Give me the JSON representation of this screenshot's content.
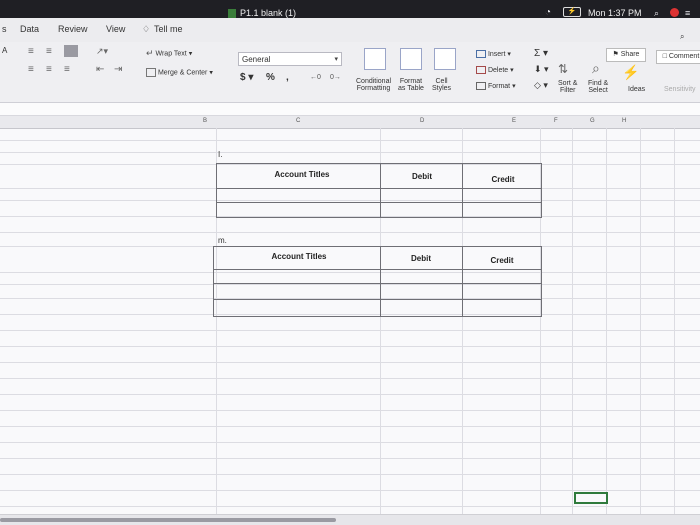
{
  "app": {
    "window_title": "P1.1 blank (1)",
    "clock": "Mon 1:37 PM"
  },
  "tabs": {
    "items": [
      "s",
      "Data",
      "Review",
      "View",
      "Tell me"
    ]
  },
  "ribbon": {
    "wrap_text": "Wrap Text",
    "merge_center": "Merge & Center",
    "number_format": "General",
    "currency": "$",
    "percent": "%",
    "comma": ",",
    "conditional_formatting_1": "Conditional",
    "conditional_formatting_2": "Formatting",
    "format_as_table_1": "Format",
    "format_as_table_2": "as Table",
    "cell_styles_1": "Cell",
    "cell_styles_2": "Styles",
    "insert": "Insert",
    "delete": "Delete",
    "format": "Format",
    "sort_filter_1": "Sort &",
    "sort_filter_2": "Filter",
    "find_select_1": "Find &",
    "find_select_2": "Select",
    "ideas": "Ideas",
    "sensitivity": "Sensitivity",
    "share": "Share",
    "comments": "Comment",
    "font_size_label": "A"
  },
  "columns": {
    "headers": [
      "B",
      "C",
      "D",
      "E",
      "F",
      "G",
      "H"
    ]
  },
  "sheet": {
    "section_1_label": "I.",
    "section_2_label": "m.",
    "table_1": {
      "headers": [
        "Account Titles",
        "Debit",
        "Credit"
      ]
    },
    "table_2": {
      "headers": [
        "Account Titles",
        "Debit",
        "Credit"
      ]
    }
  }
}
